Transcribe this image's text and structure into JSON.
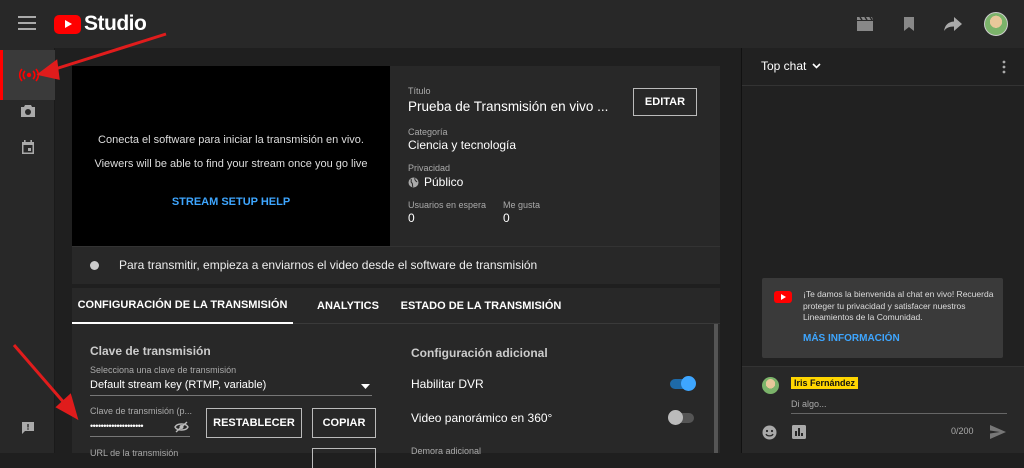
{
  "header": {
    "brand": "Studio",
    "icons": [
      "menu-icon",
      "youtube-logo",
      "clapperboard-icon",
      "bookmark-icon",
      "share-icon",
      "avatar"
    ]
  },
  "leftnav": {
    "items": [
      "live-stream-icon",
      "camera-icon",
      "calendar-icon",
      "feedback-icon"
    ]
  },
  "preview": {
    "line1": "Conecta el software para iniciar la transmisión en vivo.",
    "line2": "Viewers will be able to find your stream once you go live",
    "help": "STREAM SETUP HELP"
  },
  "meta": {
    "title_label": "Título",
    "title": "Prueba de Transmisión en vivo ...",
    "category_label": "Categoría",
    "category": "Ciencia y tecnología",
    "privacy_label": "Privacidad",
    "privacy": "Público",
    "waiting_label": "Usuarios en espera",
    "waiting": "0",
    "likes_label": "Me gusta",
    "likes": "0",
    "edit": "EDITAR"
  },
  "status": {
    "text": "Para transmitir, empieza a enviarnos el video desde el software de transmisión"
  },
  "tabs": [
    "CONFIGURACIÓN DE LA TRANSMISIÓN",
    "ANALYTICS",
    "ESTADO DE LA TRANSMISIÓN"
  ],
  "settings": {
    "key_title": "Clave de transmisión",
    "select_label": "Selecciona una clave de transmisión",
    "select_value": "Default stream key (RTMP, variable)",
    "key_label": "Clave de transmisión (p...",
    "key_value": "••••••••••••••••••••",
    "reset": "RESTABLECER",
    "copy": "COPIAR",
    "url_label": "URL de la transmisión",
    "extra_title": "Configuración adicional",
    "dvr_label": "Habilitar DVR",
    "dvr_on": true,
    "pano_label": "Video panorámico en 360°",
    "pano_on": false,
    "delay_label": "Demora adicional"
  },
  "chat": {
    "mode": "Top chat",
    "welcome": "¡Te damos la bienvenida al chat en vivo! Recuerda proteger tu privacidad y satisfacer nuestros Lineamientos de la Comunidad.",
    "more": "MÁS INFORMACIÓN",
    "user": "Iris Fernández",
    "placeholder": "Di algo...",
    "count": "0/200"
  },
  "colors": {
    "accent": "#ff0000",
    "link": "#3ea6ff",
    "toggle_on": "#3ea6ff",
    "name_badge": "#ffd600"
  }
}
